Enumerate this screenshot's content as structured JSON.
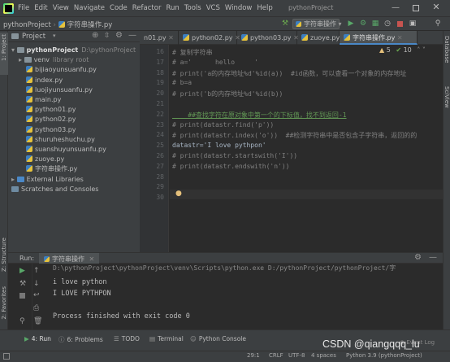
{
  "menu": [
    "File",
    "Edit",
    "View",
    "Navigate",
    "Code",
    "Refactor",
    "Run",
    "Tools",
    "VCS",
    "Window",
    "Help"
  ],
  "window_title": "pythonProject",
  "breadcrumb": {
    "project": "pythonProject",
    "file": "字符串操作.py"
  },
  "run_config": "字符串操作",
  "side_tabs": {
    "project": "1: Project",
    "structure": "Z: Structure",
    "favorites": "2: Favorites",
    "database": "Database",
    "sciview": "SciView"
  },
  "project_panel": {
    "title": "Project"
  },
  "editor_tabs": [
    "n01.py",
    "python02.py",
    "python03.py",
    "zuoye.py",
    "字符串操作.py"
  ],
  "tree": [
    {
      "label": "pythonProject",
      "extra": "D:\\pythonProject",
      "type": "folder",
      "level": 0,
      "expanded": true
    },
    {
      "label": "venv",
      "extra": "library root",
      "type": "folder",
      "level": 1,
      "expanded": false
    },
    {
      "label": "bijiaoyunsuanfu.py",
      "type": "py",
      "level": 2
    },
    {
      "label": "index.py",
      "type": "py",
      "level": 2
    },
    {
      "label": "luojiyunsuanfu.py",
      "type": "py",
      "level": 2
    },
    {
      "label": "main.py",
      "type": "py",
      "level": 2
    },
    {
      "label": "python01.py",
      "type": "py",
      "level": 2
    },
    {
      "label": "python02.py",
      "type": "py",
      "level": 2
    },
    {
      "label": "python03.py",
      "type": "py",
      "level": 2
    },
    {
      "label": "shuruheshuchu.py",
      "type": "py",
      "level": 2
    },
    {
      "label": "suanshuyunsuanfu.py",
      "type": "py",
      "level": 2
    },
    {
      "label": "zuoye.py",
      "type": "py",
      "level": 2
    },
    {
      "label": "字符串操作.py",
      "type": "py",
      "level": 2
    },
    {
      "label": "External Libraries",
      "type": "lib",
      "level": 0,
      "expanded": false
    },
    {
      "label": "Scratches and Consoles",
      "type": "scratch",
      "level": 0
    }
  ],
  "inspections": {
    "warnings": "5",
    "weak": "10"
  },
  "code_lines": [
    {
      "n": "16",
      "text": "# 复制字符串"
    },
    {
      "n": "17",
      "text": "# a='      hello     '"
    },
    {
      "n": "18",
      "text": "# print('a的内存地址%d'%id(a))  #id函数，可以查看一个对象的内存地址"
    },
    {
      "n": "19",
      "text": "# b=a"
    },
    {
      "n": "20",
      "text": "# print('b的内存地址%d'%id(b))"
    },
    {
      "n": "21",
      "text": ""
    },
    {
      "n": "22",
      "text": "    ##查找字符在原对象中第一个的下标值，找不到返回-1"
    },
    {
      "n": "23",
      "text": "# print(datastr.find('p'))"
    },
    {
      "n": "24",
      "text": "# print(datastr.index('o'))  ##检测字符串中是否包含子字符串，返回的的"
    },
    {
      "n": "25",
      "text": "datastr='I love pythpon'"
    },
    {
      "n": "26",
      "text": "# print(datastr.startswith('I'))"
    },
    {
      "n": "27",
      "text": "# print(datastr.endswith('n'))"
    },
    {
      "n": "28",
      "text": ""
    },
    {
      "n": "29",
      "text": ""
    },
    {
      "n": "30",
      "text": ""
    }
  ],
  "run": {
    "label": "Run:",
    "tab": "字符串操作",
    "output": [
      "D:\\pythonProject\\pythonProject\\venv\\Scripts\\python.exe D:/pythonProject/pythonProject/字",
      "i love python",
      "I LOVE PYTHPON",
      "",
      "Process finished with exit code 0"
    ]
  },
  "bottom_tabs": [
    "4: Run",
    "6: Problems",
    "TODO",
    "Terminal",
    "Python Console"
  ],
  "event_log": "Event Log",
  "status": {
    "pos": "29:1",
    "crlf": "CRLF",
    "enc": "UTF-8",
    "indent": "4 spaces",
    "interp": "Python 3.9 (pythonProject)"
  },
  "watermark": "CSDN @qiangqqq_lu"
}
